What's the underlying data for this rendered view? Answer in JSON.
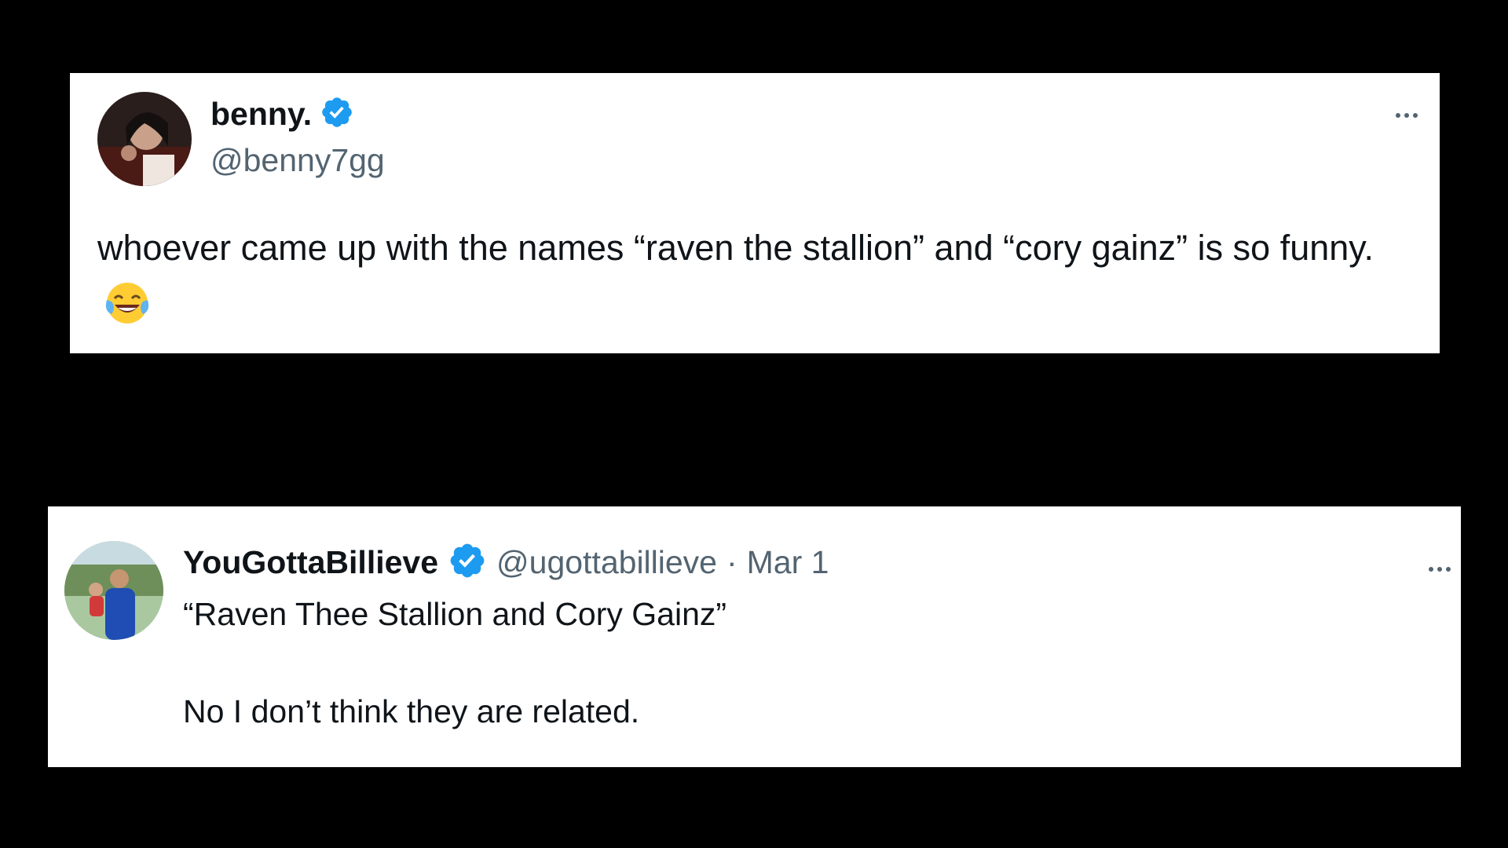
{
  "tweets": [
    {
      "display_name": "benny.",
      "verified": true,
      "handle": "@benny7gg",
      "date": "",
      "text_lines": [
        "whoever came up with the names “raven the stallion” and “cory gainz” is so funny."
      ],
      "emoji": "face-with-tears-of-joy"
    },
    {
      "display_name": "YouGottaBillieve",
      "verified": true,
      "handle": "@ugottabillieve",
      "separator": "·",
      "date": "Mar 1",
      "text_lines": [
        "“Raven Thee Stallion and Cory Gainz”",
        "No I don’t think they are related."
      ]
    }
  ],
  "colors": {
    "background": "#000000",
    "card": "#ffffff",
    "text_primary": "#0f1419",
    "text_secondary": "#536471",
    "verified_badge": "#1d9bf0"
  },
  "icons": {
    "verified": "verified-badge-icon",
    "more": "more-options-icon"
  }
}
